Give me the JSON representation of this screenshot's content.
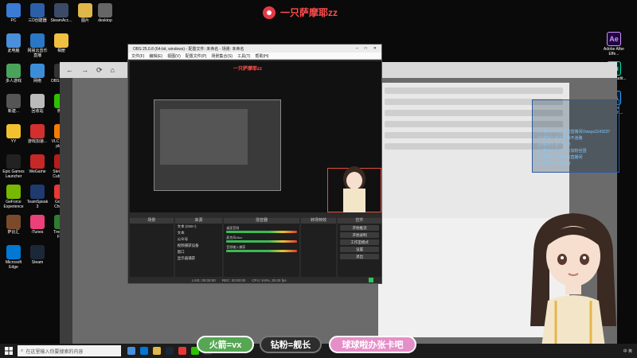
{
  "stream_title": "一只萨摩耶zz",
  "desktop_icons_left": [
    {
      "label": "PC",
      "color": "#3a7bd5"
    },
    {
      "label": "三D创建器",
      "color": "#2b5fa8"
    },
    {
      "label": "SteamAcc...",
      "color": "#3b4a66"
    },
    {
      "label": "图片",
      "color": "#e0b84a"
    },
    {
      "label": "desktop",
      "color": "#666"
    },
    {
      "label": "此电脑",
      "color": "#4a8fd9"
    },
    {
      "label": "网易云音乐直播",
      "color": "#2a77c6"
    },
    {
      "label": "相册",
      "color": "#f0c040"
    },
    {
      "label": "多人游戏",
      "color": "#4aa35a"
    },
    {
      "label": "网络",
      "color": "#3c8dd8"
    },
    {
      "label": "OBS Studio",
      "color": "#333"
    },
    {
      "label": "新建...",
      "color": "#555"
    },
    {
      "label": "回收站",
      "color": "#bbb"
    },
    {
      "label": "微信",
      "color": "#2dc100"
    },
    {
      "label": "YY",
      "color": "#f2c12e"
    },
    {
      "label": "游戏加速...",
      "color": "#d32f2f"
    },
    {
      "label": "VLC media player",
      "color": "#f57c00"
    },
    {
      "label": "Epic Games Launcher",
      "color": "#222"
    },
    {
      "label": "WeGame",
      "color": "#c62828"
    },
    {
      "label": "Steinberg Cubase 5",
      "color": "#b71c1c"
    },
    {
      "label": "GeForce Experience",
      "color": "#76b900"
    },
    {
      "label": "TeamSpeak 3",
      "color": "#1e3a6e"
    },
    {
      "label": "Google Chrome",
      "color": "#e53935"
    },
    {
      "label": "萨比汇",
      "color": "#7b4a2b"
    },
    {
      "label": "iTunes",
      "color": "#ec407a"
    },
    {
      "label": "TreeSize Free",
      "color": "#2e7d32"
    },
    {
      "label": "Microsoft Edge",
      "color": "#0078d4"
    },
    {
      "label": "Steam",
      "color": "#1b2838"
    }
  ],
  "desktop_icons_right": [
    {
      "label": "Adobe After Effe...",
      "abbr": "Ae",
      "color": "#1f0740",
      "fg": "#d291ff"
    },
    {
      "label": "Adobe Audit...",
      "abbr": "Au",
      "color": "#00261c",
      "fg": "#00e4bb"
    },
    {
      "label": "Adobe Photosh...",
      "abbr": "Ps",
      "color": "#001e36",
      "fg": "#31a8ff"
    }
  ],
  "obs": {
    "title": "OBS 25.0.8 (64-bit, windows) - 配置文件: 未命名 - 场景: 未命名",
    "menu": [
      "文件(F)",
      "编辑(E)",
      "视图(V)",
      "配置文件(P)",
      "场景集合(S)",
      "工具(T)",
      "帮助(H)"
    ],
    "preview_title": "一只萨摩耶zz",
    "preview_pills": [
      "火箭=vx",
      "钻粉=舰长",
      "球球啦办张卡吧"
    ],
    "dock_headers": [
      "场景",
      "来源",
      "混音器",
      "转场特效",
      "控件"
    ],
    "sources": [
      "文本 (GDI+)",
      "文本",
      "公众号",
      "视频捕获设备",
      "窗口",
      "显示器捕获"
    ],
    "mixer_tracks": [
      "桌面音频",
      "麦克风/Aux",
      "音频输入捕获"
    ],
    "controls": [
      "开始推流",
      "开始录制",
      "工作室模式",
      "设置",
      "退出"
    ],
    "status": [
      "LIVE: 00:00:00",
      "REC: 00:00:00",
      "CPU: 9.8%, 30.00 fps"
    ]
  },
  "chat_overlay": [
    "[小助手]: 欢迎来到直播间Owayu1143237",
    "[小助手]: 关注主播不迷路",
    "[小助手]: 点个赞吧",
    "[小助手]: 喜欢可以加粉丝团",
    "[小助手]: 欢迎来到直播间",
    "[小助手]: 感谢支持"
  ],
  "bottom_pills": [
    "火箭=vx",
    "钻粉=舰长",
    "球球啦办张卡吧"
  ],
  "taskbar": {
    "search_placeholder": "在这里输入你要搜索的内容",
    "tray": "中 英"
  },
  "colors": {
    "accent_red": "#ff4d4d",
    "pill_green": "#56a653",
    "pill_pink": "#e58fc8",
    "obs_bg": "#2b2b2b"
  }
}
